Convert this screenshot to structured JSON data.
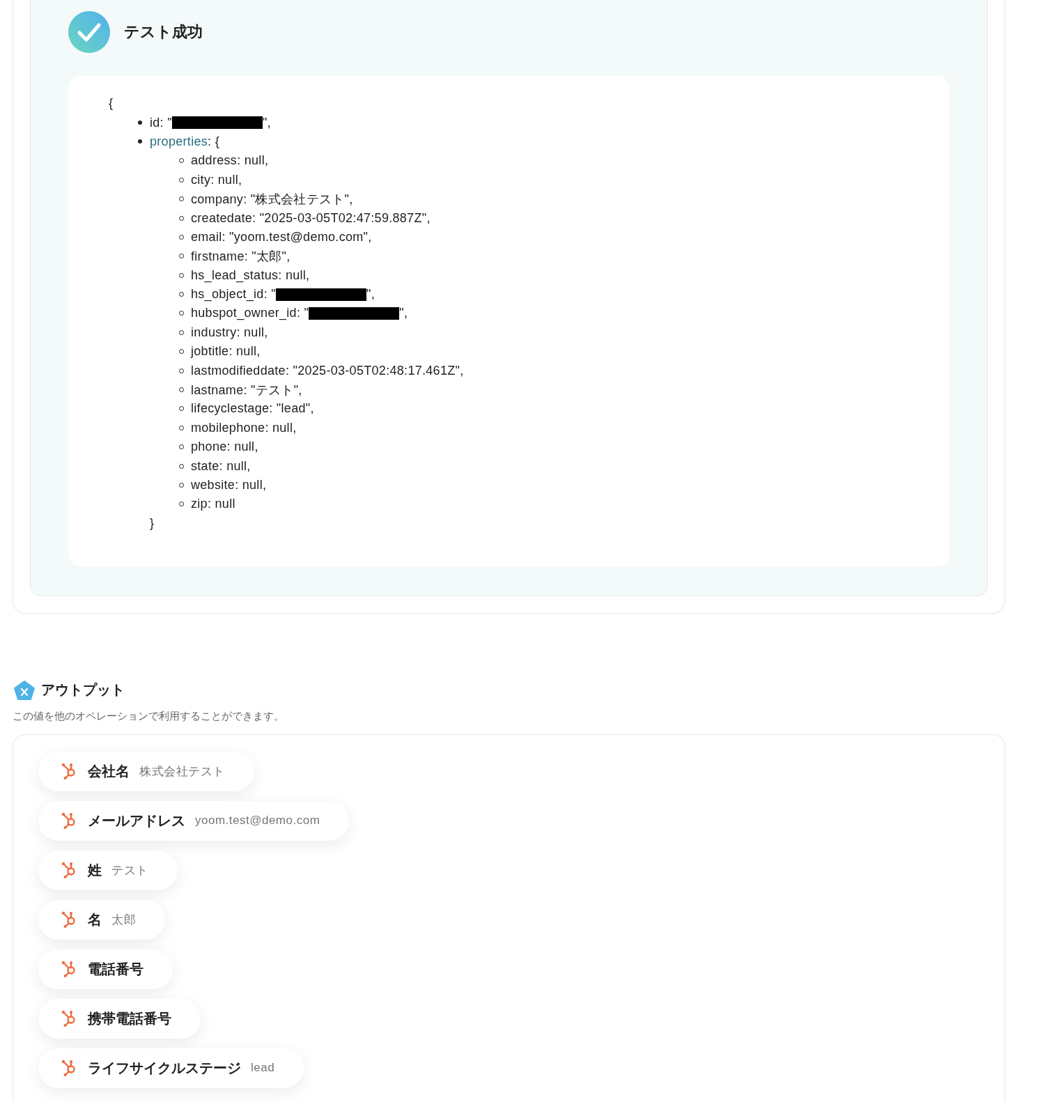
{
  "result": {
    "title": "テスト成功",
    "code": {
      "open": "{",
      "fields": [
        {
          "kind": "redacted",
          "before": "id: \"",
          "after": "\","
        },
        {
          "kind": "object",
          "key": "properties",
          "after": ": {",
          "close": "}",
          "children": [
            {
              "kind": "plain",
              "text": "address: null,"
            },
            {
              "kind": "plain",
              "text": "city: null,"
            },
            {
              "kind": "plain",
              "text": "company: \"株式会社テスト\","
            },
            {
              "kind": "plain",
              "text": "createdate: \"2025-03-05T02:47:59.887Z\","
            },
            {
              "kind": "plain",
              "text": "email: \"yoom.test@demo.com\","
            },
            {
              "kind": "plain",
              "text": "firstname: \"太郎\","
            },
            {
              "kind": "plain",
              "text": "hs_lead_status: null,"
            },
            {
              "kind": "redacted",
              "before": "hs_object_id: \"",
              "after": "\","
            },
            {
              "kind": "redacted",
              "before": "hubspot_owner_id: \"",
              "after": "\","
            },
            {
              "kind": "plain",
              "text": "industry: null,"
            },
            {
              "kind": "plain",
              "text": "jobtitle: null,"
            },
            {
              "kind": "plain",
              "text": "lastmodifieddate: \"2025-03-05T02:48:17.461Z\","
            },
            {
              "kind": "plain",
              "text": "lastname: \"テスト\","
            },
            {
              "kind": "plain",
              "text": "lifecyclestage: \"lead\","
            },
            {
              "kind": "plain",
              "text": "mobilephone: null,"
            },
            {
              "kind": "plain",
              "text": "phone: null,"
            },
            {
              "kind": "plain",
              "text": "state: null,"
            },
            {
              "kind": "plain",
              "text": "website: null,"
            },
            {
              "kind": "plain",
              "text": "zip: null"
            }
          ]
        }
      ]
    }
  },
  "output": {
    "title": "アウトプット",
    "description": "この値を他のオペレーションで利用することができます。",
    "items": [
      {
        "label": "会社名",
        "value": "株式会社テスト"
      },
      {
        "label": "メールアドレス",
        "value": "yoom.test@demo.com"
      },
      {
        "label": "姓",
        "value": "テスト"
      },
      {
        "label": "名",
        "value": "太郎"
      },
      {
        "label": "電話番号"
      },
      {
        "label": "携帯電話番号"
      },
      {
        "label": "ライフサイクルステージ",
        "value": "lead"
      }
    ]
  }
}
